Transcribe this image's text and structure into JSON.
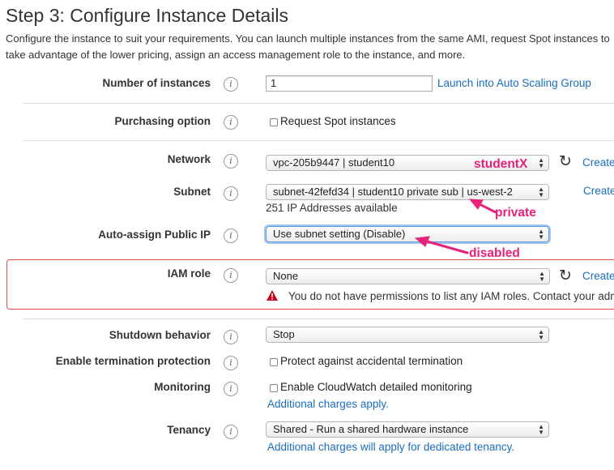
{
  "page": {
    "title": "Step 3: Configure Instance Details",
    "description": "Configure the instance to suit your requirements. You can launch multiple instances from the same AMI, request Spot instances to take advantage of the lower pricing, assign an access management role to the instance, and more."
  },
  "fields": {
    "num_instances": {
      "label": "Number of instances",
      "value": "1",
      "link": "Launch into Auto Scaling Group"
    },
    "purchasing": {
      "label": "Purchasing option",
      "checkbox": "Request Spot instances"
    },
    "network": {
      "label": "Network",
      "value": "vpc-205b9447 | student10",
      "link": "Create"
    },
    "subnet": {
      "label": "Subnet",
      "value": "subnet-42fefd34 | student10 private sub | us-west-2",
      "note": "251 IP Addresses available",
      "link": "Create"
    },
    "public_ip": {
      "label": "Auto-assign Public IP",
      "value": "Use subnet setting (Disable)"
    },
    "iam_role": {
      "label": "IAM role",
      "value": "None",
      "link": "Create",
      "warning": "You do not have permissions to list any IAM roles. Contact your administrator"
    },
    "shutdown": {
      "label": "Shutdown behavior",
      "value": "Stop"
    },
    "termination": {
      "label": "Enable termination protection",
      "checkbox": "Protect against accidental termination"
    },
    "monitoring": {
      "label": "Monitoring",
      "checkbox": "Enable CloudWatch detailed monitoring",
      "note": "Additional charges apply."
    },
    "tenancy": {
      "label": "Tenancy",
      "value": "Shared - Run a shared hardware instance",
      "note": "Additional charges will apply for dedicated tenancy."
    }
  },
  "annotations": {
    "network": "studentX",
    "subnet": "private",
    "public_ip": "disabled"
  },
  "icons": {
    "info": "i",
    "refresh": "↻",
    "warning": "warning-triangle",
    "caret_up": "▲",
    "caret_down": "▼"
  },
  "colors": {
    "link": "#1a6dbd",
    "annotation": "#e8217a",
    "error_border": "#d9534f",
    "warning": "#d0021b",
    "focus": "#5b9bd5"
  }
}
